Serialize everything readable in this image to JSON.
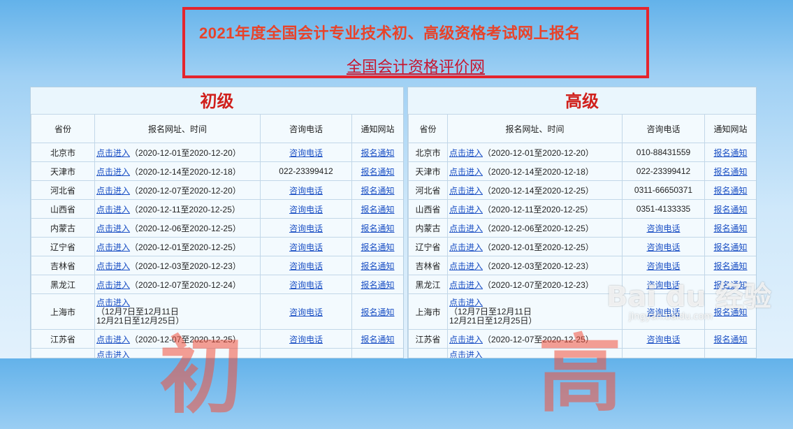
{
  "header": {
    "title": "2021年度全国会计专业技术初、高级资格考试网上报名",
    "link": "全国会计资格评价网"
  },
  "left": {
    "title": "初级",
    "columns": [
      "省份",
      "报名网址、时间",
      "咨询电话",
      "通知网站"
    ],
    "rows": [
      {
        "province": "北京市",
        "link": "点击进入",
        "date": "（2020-12-01至2020-12-20）",
        "phone": "咨询电话",
        "phone_link": true,
        "notice": "报名通知"
      },
      {
        "province": "天津市",
        "link": "点击进入",
        "date": "（2020-12-14至2020-12-18）",
        "phone": "022-23399412",
        "phone_link": false,
        "notice": "报名通知"
      },
      {
        "province": "河北省",
        "link": "点击进入",
        "date": "（2020-12-07至2020-12-20）",
        "phone": "咨询电话",
        "phone_link": true,
        "notice": "报名通知"
      },
      {
        "province": "山西省",
        "link": "点击进入",
        "date": "（2020-12-11至2020-12-25）",
        "phone": "咨询电话",
        "phone_link": true,
        "notice": "报名通知"
      },
      {
        "province": "内蒙古",
        "link": "点击进入",
        "date": "（2020-12-06至2020-12-25）",
        "phone": "咨询电话",
        "phone_link": true,
        "notice": "报名通知"
      },
      {
        "province": "辽宁省",
        "link": "点击进入",
        "date": "（2020-12-01至2020-12-25）",
        "phone": "咨询电话",
        "phone_link": true,
        "notice": "报名通知"
      },
      {
        "province": "吉林省",
        "link": "点击进入",
        "date": "（2020-12-03至2020-12-23）",
        "phone": "咨询电话",
        "phone_link": true,
        "notice": "报名通知"
      },
      {
        "province": "黑龙江",
        "link": "点击进入",
        "date": "（2020-12-07至2020-12-24）",
        "phone": "咨询电话",
        "phone_link": true,
        "notice": "报名通知"
      }
    ],
    "shanghai": {
      "province": "上海市",
      "link": "点击进入",
      "line1": "（12月7日至12月11日",
      "line2": "12月21日至12月25日）",
      "phone": "咨询电话",
      "notice": "报名通知"
    },
    "jiangsu": {
      "province": "江苏省",
      "link": "点击进入",
      "date": "（2020-12-07至2020-12-25）",
      "phone": "咨询电话",
      "notice": "报名通知"
    },
    "last_link": "点击进入"
  },
  "right": {
    "title": "高级",
    "columns": [
      "省份",
      "报名网址、时间",
      "咨询电话",
      "通知网站"
    ],
    "rows": [
      {
        "province": "北京市",
        "link": "点击进入",
        "date": "（2020-12-01至2020-12-20）",
        "phone": "010-88431559",
        "phone_link": false,
        "notice": "报名通知"
      },
      {
        "province": "天津市",
        "link": "点击进入",
        "date": "（2020-12-14至2020-12-18）",
        "phone": "022-23399412",
        "phone_link": false,
        "notice": "报名通知"
      },
      {
        "province": "河北省",
        "link": "点击进入",
        "date": "（2020-12-14至2020-12-25）",
        "phone": "0311-66650371",
        "phone_link": false,
        "notice": "报名通知"
      },
      {
        "province": "山西省",
        "link": "点击进入",
        "date": "（2020-12-11至2020-12-25）",
        "phone": "0351-4133335",
        "phone_link": false,
        "notice": "报名通知"
      },
      {
        "province": "内蒙古",
        "link": "点击进入",
        "date": "（2020-12-06至2020-12-25）",
        "phone": "咨询电话",
        "phone_link": true,
        "notice": "报名通知"
      },
      {
        "province": "辽宁省",
        "link": "点击进入",
        "date": "（2020-12-01至2020-12-25）",
        "phone": "咨询电话",
        "phone_link": true,
        "notice": "报名通知"
      },
      {
        "province": "吉林省",
        "link": "点击进入",
        "date": "（2020-12-03至2020-12-23）",
        "phone": "咨询电话",
        "phone_link": true,
        "notice": "报名通知"
      },
      {
        "province": "黑龙江",
        "link": "点击进入",
        "date": "（2020-12-07至2020-12-23）",
        "phone": "咨询电话",
        "phone_link": true,
        "notice": "报名通知"
      }
    ],
    "shanghai": {
      "province": "上海市",
      "link": "点击进入",
      "line1": "（12月7日至12月11日",
      "line2": "12月21日至12月25日）",
      "phone": "咨询电话",
      "notice": "报名通知"
    },
    "jiangsu": {
      "province": "江苏省",
      "link": "点击进入",
      "date": "（2020-12-07至2020-12-25）",
      "phone": "咨询电话",
      "notice": "报名通知"
    },
    "last_link": "点击进入"
  },
  "watermark": {
    "left_char": "初",
    "right_char": "高",
    "baidu": "Bai du 经验",
    "baidu_sub": "jingyan.baidu.com"
  }
}
